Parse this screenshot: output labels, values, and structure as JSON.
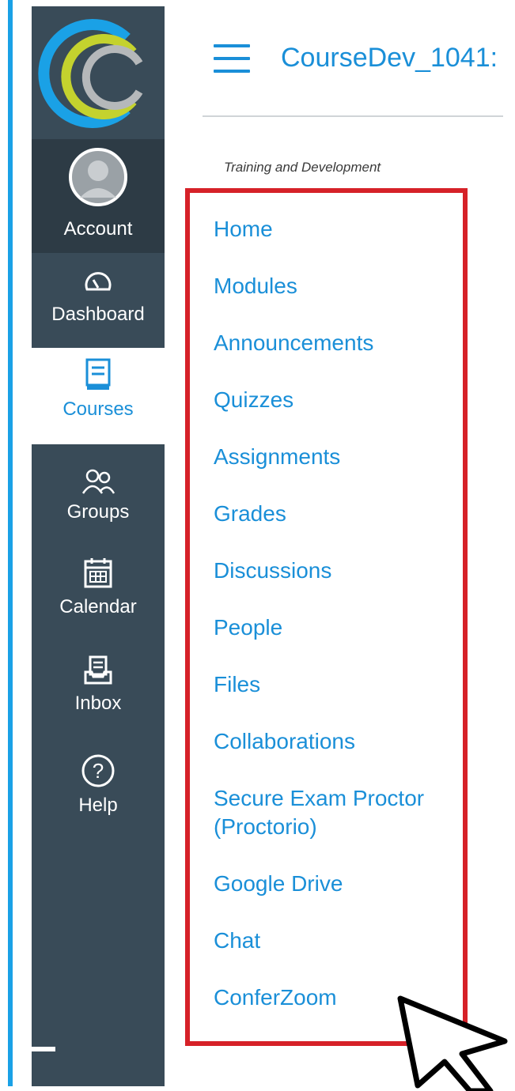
{
  "global_nav": {
    "items": [
      {
        "label": "Account",
        "icon": "account-avatar-icon"
      },
      {
        "label": "Dashboard",
        "icon": "dashboard-icon"
      },
      {
        "label": "Courses",
        "icon": "courses-icon"
      },
      {
        "label": "Groups",
        "icon": "groups-icon"
      },
      {
        "label": "Calendar",
        "icon": "calendar-icon"
      },
      {
        "label": "Inbox",
        "icon": "inbox-icon"
      },
      {
        "label": "Help",
        "icon": "help-icon"
      }
    ]
  },
  "header": {
    "course_title": "CourseDev_1041:",
    "subaccount": "Training and Development"
  },
  "course_nav": {
    "items": [
      {
        "label": "Home"
      },
      {
        "label": "Modules"
      },
      {
        "label": "Announcements"
      },
      {
        "label": "Quizzes"
      },
      {
        "label": "Assignments"
      },
      {
        "label": "Grades"
      },
      {
        "label": "Discussions"
      },
      {
        "label": "People"
      },
      {
        "label": "Files"
      },
      {
        "label": "Collaborations"
      },
      {
        "label": "Secure Exam Proctor (Proctorio)"
      },
      {
        "label": "Google Drive"
      },
      {
        "label": "Chat"
      },
      {
        "label": "ConferZoom"
      }
    ]
  },
  "colors": {
    "nav_background": "#394b58",
    "nav_active_background": "#ffffff",
    "link_blue": "#1a8fd8",
    "highlight_red": "#d62128",
    "accent_bar": "#1aa1e6"
  }
}
